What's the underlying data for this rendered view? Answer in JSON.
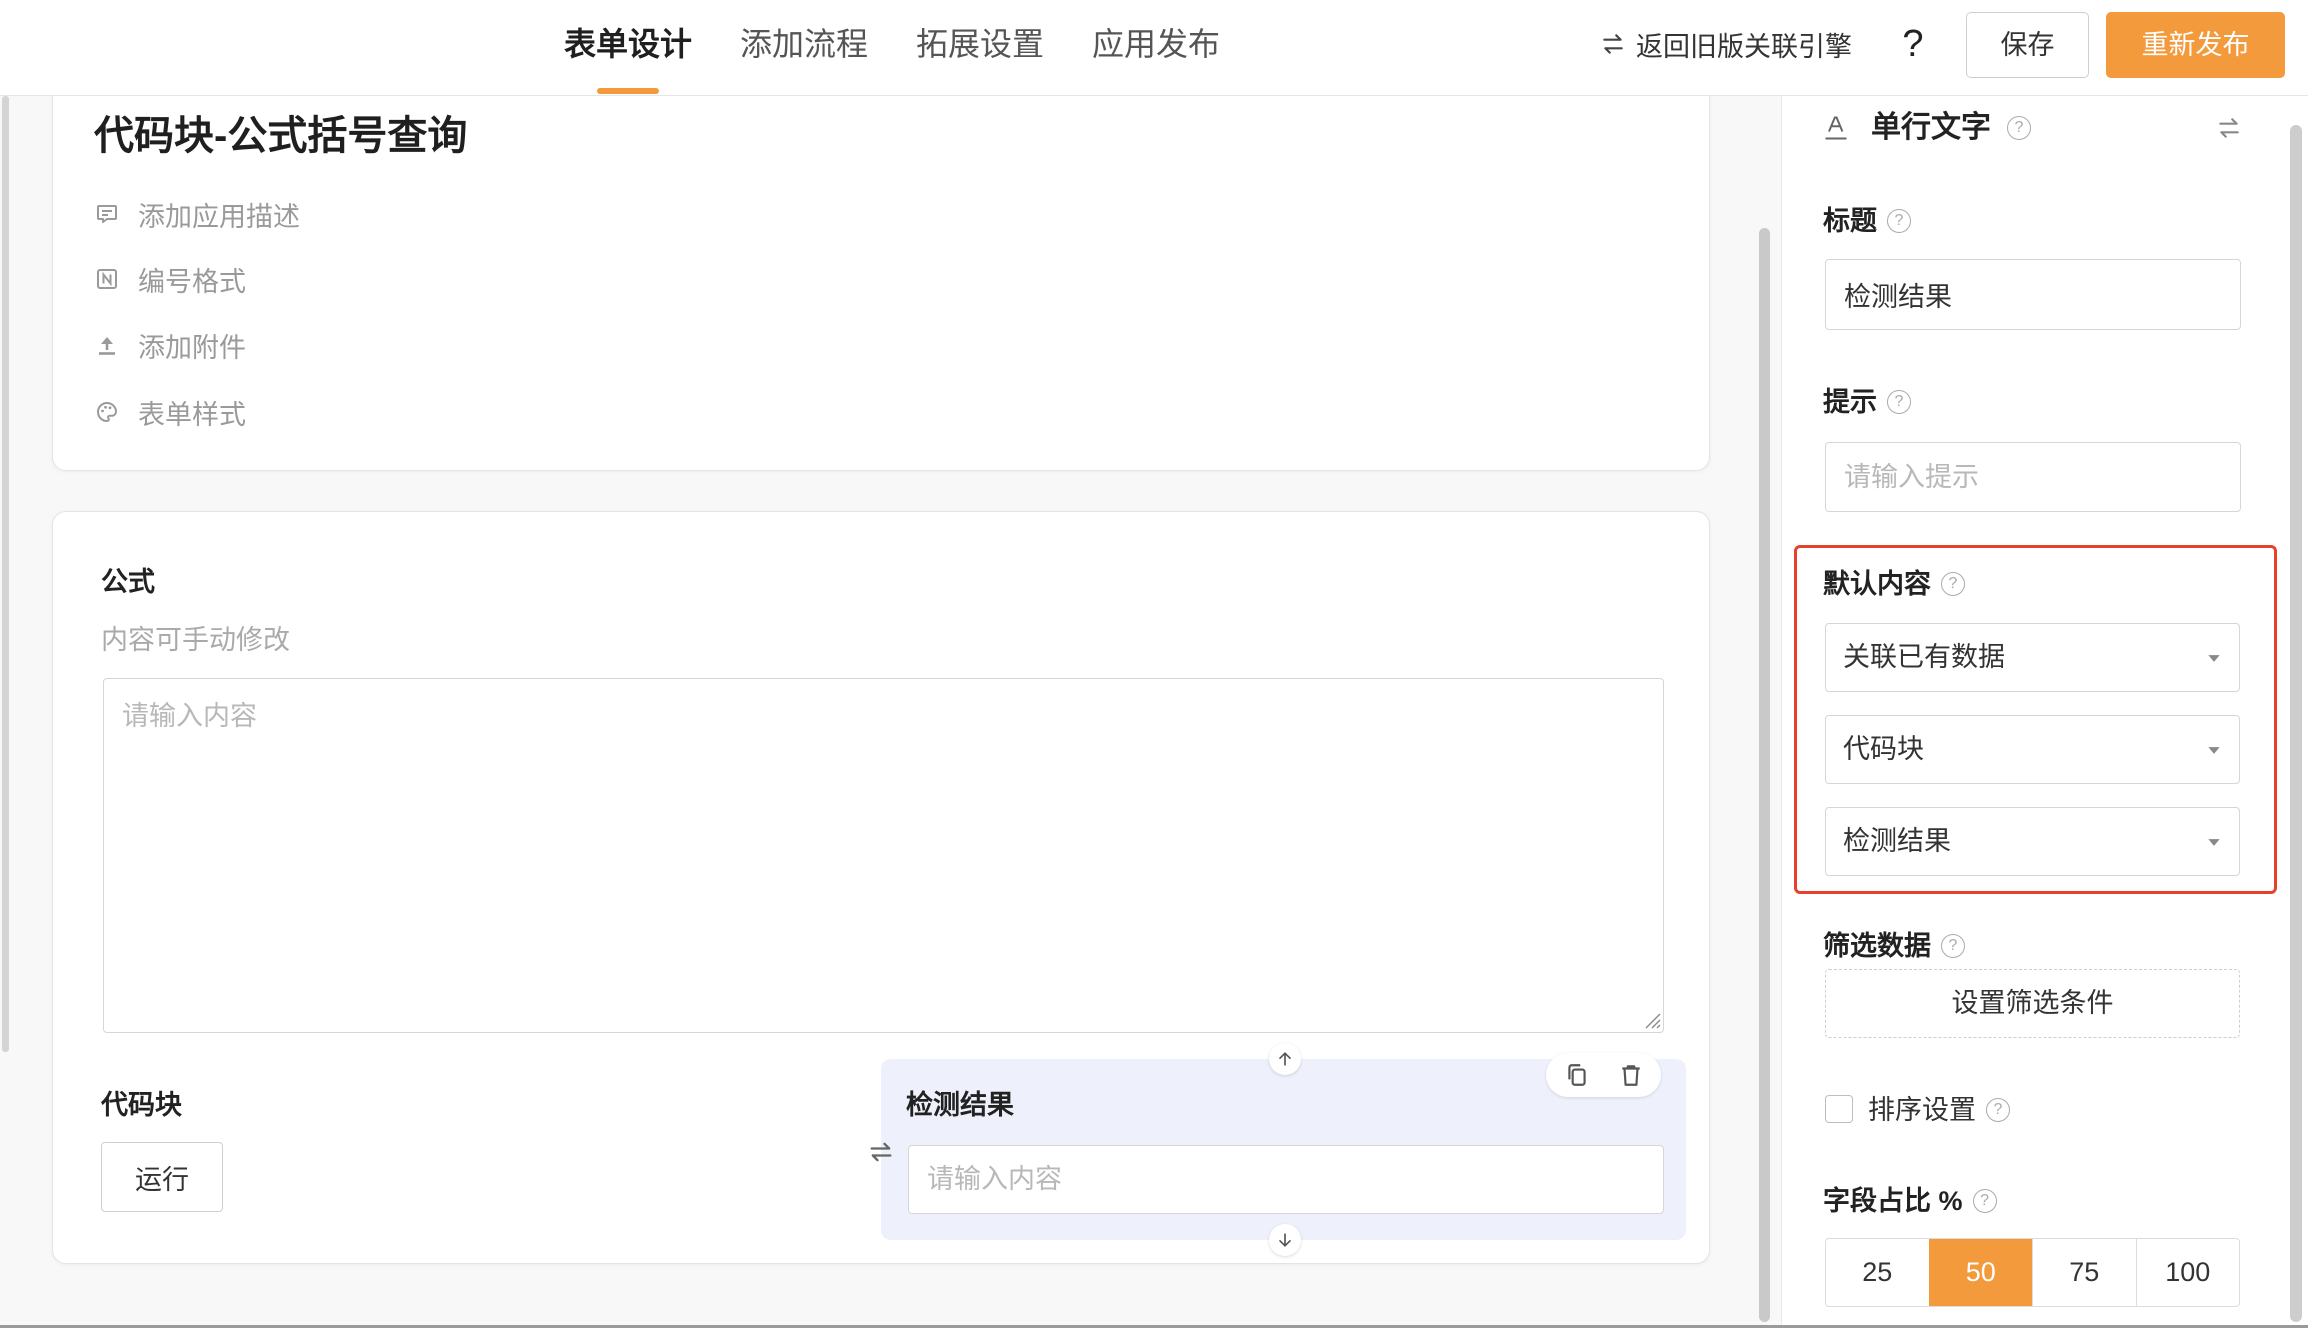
{
  "topbar": {
    "tabs": [
      {
        "label": "表单设计",
        "active": true
      },
      {
        "label": "添加流程",
        "active": false
      },
      {
        "label": "拓展设置",
        "active": false
      },
      {
        "label": "应用发布",
        "active": false
      }
    ],
    "legacy_link_label": "返回旧版关联引擎",
    "help_label": "?",
    "save_label": "保存",
    "publish_label": "重新发布"
  },
  "form_header": {
    "title": "代码块-公式括号查询",
    "actions": [
      {
        "icon": "comment-icon",
        "label": "添加应用描述"
      },
      {
        "icon": "numbering-icon",
        "label": "编号格式"
      },
      {
        "icon": "upload-icon",
        "label": "添加附件"
      },
      {
        "icon": "palette-icon",
        "label": "表单样式"
      }
    ]
  },
  "form_body": {
    "formula_field": {
      "label": "公式",
      "description": "内容可手动修改",
      "placeholder": "请输入内容"
    },
    "code_block_field": {
      "label": "代码块",
      "run_label": "运行"
    },
    "result_field": {
      "label": "检测结果",
      "placeholder": "请输入内容",
      "selected": true
    }
  },
  "properties_panel": {
    "field_type_icon": "text-field-icon",
    "field_type": "单行文字",
    "title": {
      "label": "标题",
      "value": "检测结果"
    },
    "hint": {
      "label": "提示",
      "placeholder": "请输入提示"
    },
    "default_content": {
      "label": "默认内容",
      "source_select": "关联已有数据",
      "form_select": "代码块",
      "field_select": "检测结果"
    },
    "filter": {
      "label": "筛选数据",
      "button_label": "设置筛选条件"
    },
    "sort": {
      "label": "排序设置",
      "checked": false
    },
    "width": {
      "label": "字段占比 %",
      "options": [
        "25",
        "50",
        "75",
        "100"
      ],
      "selected": "50"
    }
  },
  "colors": {
    "accent": "#f39a3d",
    "highlight_border": "#e5412d",
    "selected_field_bg": "#eef1fb"
  }
}
